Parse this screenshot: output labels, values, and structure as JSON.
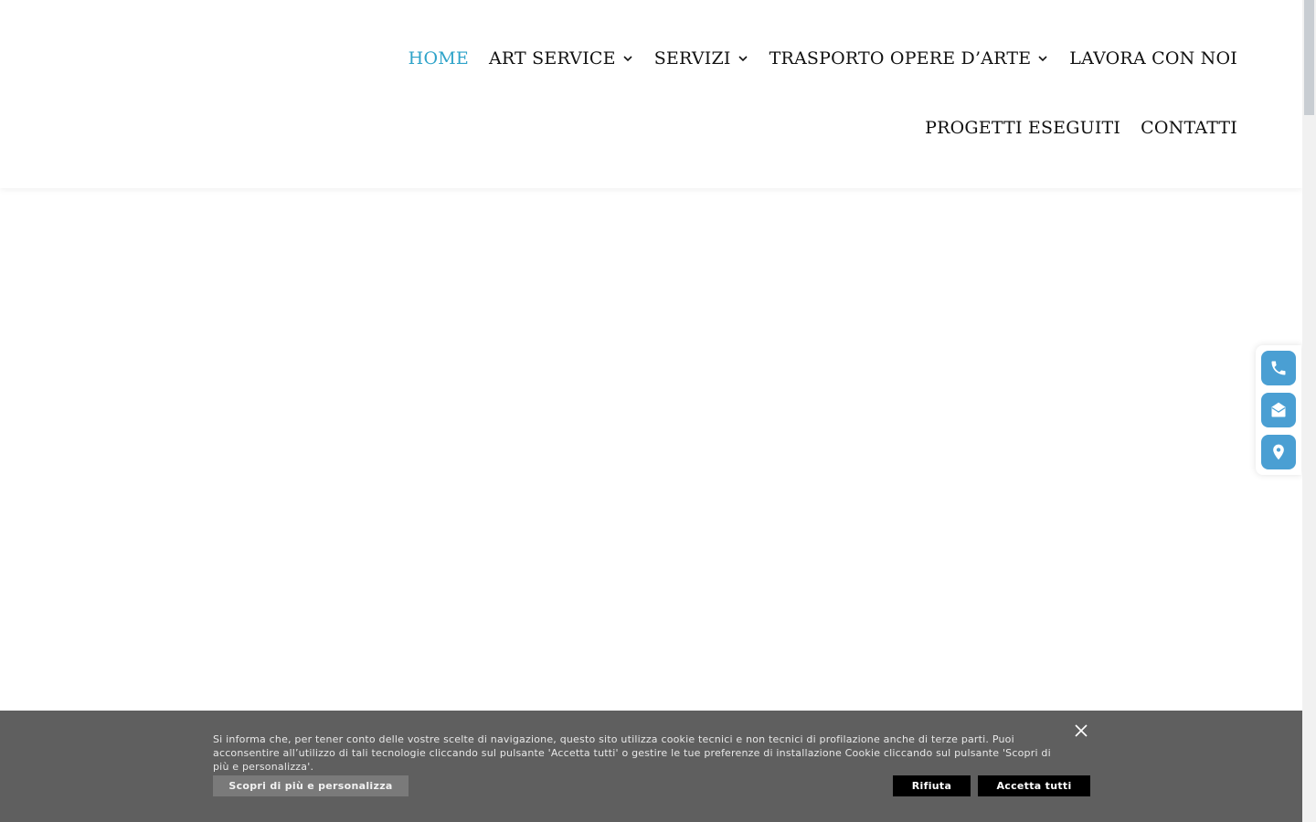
{
  "nav": {
    "row1": [
      {
        "label": "HOME",
        "active": true,
        "has_dropdown": false
      },
      {
        "label": "ART SERVICE",
        "active": false,
        "has_dropdown": true
      },
      {
        "label": "SERVIZI",
        "active": false,
        "has_dropdown": true
      },
      {
        "label": "TRASPORTO OPERE D’ARTE",
        "active": false,
        "has_dropdown": true
      },
      {
        "label": "LAVORA CON NOI",
        "active": false,
        "has_dropdown": false
      }
    ],
    "row2": [
      {
        "label": "PROGETTI ESEGUITI",
        "active": false,
        "has_dropdown": false
      },
      {
        "label": "CONTATTI",
        "active": false,
        "has_dropdown": false
      }
    ]
  },
  "floating_contacts": [
    {
      "icon": "phone-icon"
    },
    {
      "icon": "envelope-open-icon"
    },
    {
      "icon": "map-pin-icon"
    }
  ],
  "cookie": {
    "text": "Si informa che, per tener conto delle vostre scelte di navigazione, questo sito utilizza cookie tecnici e non tecnici di profilazione anche di terze parti. Puoi acconsentire all’utilizzo di tali tecnologie cliccando sul pulsante 'Accetta tutti' o gestire le tue preferenze di installazione Cookie cliccando sul pulsante 'Scopri di più e personalizza'.",
    "more_label": "Scopri di più e personalizza",
    "reject_label": "Rifiuta",
    "accept_label": "Accetta tutti"
  },
  "colors": {
    "accent": "#2ea3c9",
    "float_button": "#4a9fd3",
    "cookie_bg": "#5f5f5f"
  }
}
